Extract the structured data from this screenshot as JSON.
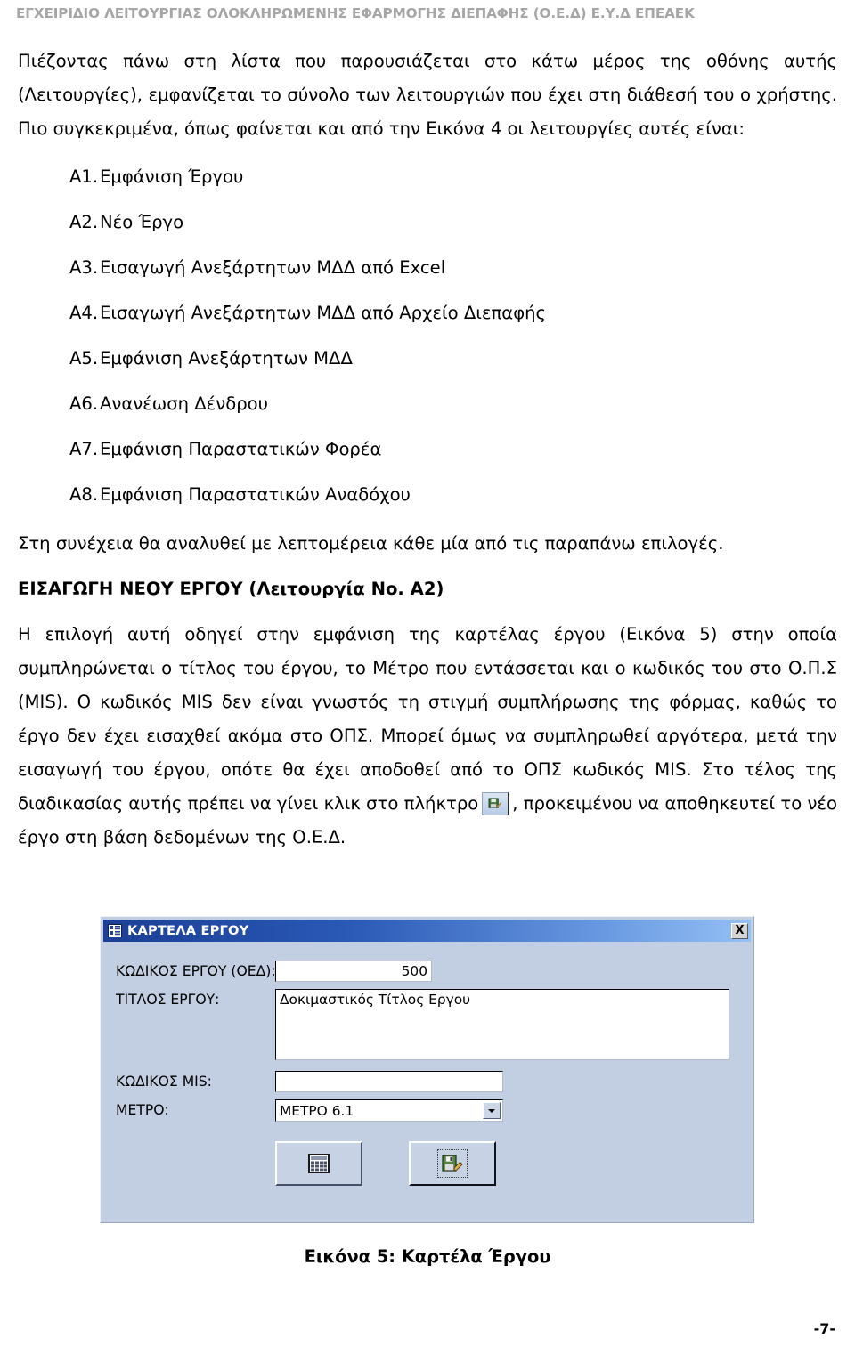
{
  "header": {
    "running_title": "ΕΓΧΕΙΡΙΔΙΟ ΛΕΙΤΟΥΡΓΙΑΣ ΟΛΟΚΛΗΡΩΜΕΝΗΣ ΕΦΑΡΜΟΓΗΣ ΔΙΕΠΑΦΗΣ (Ο.Ε.Δ) Ε.Υ.Δ ΕΠΕΑΕΚ",
    "color": "#a6a6a6"
  },
  "intro": {
    "paragraph": "Πιέζοντας πάνω στη λίστα που παρουσιάζεται στο κάτω μέρος της οθόνης αυτής (Λειτουργίες), εμφανίζεται το σύνολο των λειτουργιών που έχει στη διάθεσή του ο χρήστης. Πιο συγκεκριμένα, όπως φαίνεται και από την Εικόνα 4 οι λειτουργίες αυτές είναι:"
  },
  "functions_list": [
    {
      "key": "A1.",
      "label": "Εμφάνιση Έργου"
    },
    {
      "key": "A2.",
      "label": "Νέο Έργο"
    },
    {
      "key": "A3.",
      "label": "Εισαγωγή Ανεξάρτητων ΜΔΔ από Excel"
    },
    {
      "key": "A4.",
      "label": "Εισαγωγή Ανεξάρτητων ΜΔΔ από Αρχείο Διεπαφής"
    },
    {
      "key": "A5.",
      "label": "Εμφάνιση Ανεξάρτητων ΜΔΔ"
    },
    {
      "key": "A6.",
      "label": "Ανανέωση Δένδρου"
    },
    {
      "key": "A7.",
      "label": "Εμφάνιση Παραστατικών Φορέα"
    },
    {
      "key": "A8.",
      "label": "Εμφάνιση Παραστατικών Αναδόχου"
    }
  ],
  "after_list": {
    "paragraph": "Στη συνέχεια θα αναλυθεί με λεπτομέρεια κάθε μία από τις παραπάνω επιλογές."
  },
  "section": {
    "heading": "ΕΙΣΑΓΩΓΗ ΝΕΟΥ ΕΡΓΟΥ (Λειτουργία No. A2)",
    "para_part1": "Η επιλογή αυτή οδηγεί στην εμφάνιση της καρτέλας έργου (Εικόνα 5) στην οποία συμπληρώνεται ο τίτλος του έργου, το Μέτρο που εντάσσεται και ο κωδικός του στο Ο.Π.Σ (MIS). Ο κωδικός MIS δεν είναι γνωστός τη στιγμή συμπλήρωσης της φόρμας, καθώς το έργο δεν έχει εισαχθεί ακόμα στο ΟΠΣ. Μπορεί όμως να συμπληρωθεί αργότερα, μετά την εισαγωγή του έργου, οπότε θα έχει αποδοθεί από το ΟΠΣ κωδικός MIS. Στο τέλος της διαδικασίας αυτής πρέπει να γίνει κλικ στο πλήκτρο",
    "para_part2": ", προκειμένου να αποθηκευτεί το νέο έργο στη βάση δεδομένων της Ο.Ε.Δ.",
    "inline_button_icon": "save-disk-pencil-icon"
  },
  "dialog": {
    "title": "ΚΑΡΤΕΛΑ ΕΡΓΟΥ",
    "title_icon": "window-grid-icon",
    "close_label": "X",
    "titlebar_gradient_from": "#1b3f95",
    "titlebar_gradient_to": "#95c0f4",
    "body_color": "#c2cee2",
    "fields": [
      {
        "label": "ΚΩΔΙΚΟΣ ΕΡΓΟΥ (ΟΕΔ):",
        "value": "500"
      },
      {
        "label": "ΤΙΤΛΟΣ ΕΡΓΟΥ:",
        "value": "Δοκιμαστικός Τίτλος Εργου"
      },
      {
        "label": "ΚΩΔΙΚΟΣ MIS:",
        "value": ""
      },
      {
        "label": "ΜΕΤΡΟ:",
        "value": "ΜΕΤΡΟ 6.1"
      }
    ],
    "buttons": [
      {
        "name": "grid-button",
        "icon": "grid-table-icon"
      },
      {
        "name": "save-button",
        "icon": "save-disk-pencil-icon"
      }
    ]
  },
  "figure": {
    "caption": "Εικόνα 5: Καρτέλα Έργου"
  },
  "footer": {
    "page_number": "-7-"
  }
}
